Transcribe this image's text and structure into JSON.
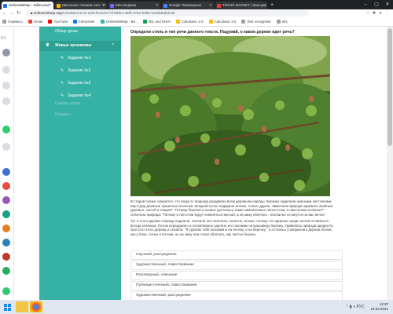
{
  "browser": {
    "tabs": [
      {
        "label": "OnlineMektep - BilimLand",
        "active": true,
        "color": "#1a73e8"
      },
      {
        "label": "Школьные Знания.com - Р",
        "active": false,
        "color": "#f4b400"
      },
      {
        "label": "Мессенджер",
        "active": false,
        "color": "#7b61ff"
      },
      {
        "label": "Google Переводчик",
        "active": false,
        "color": "#4285f4"
      },
      {
        "label": "ТЕХНО МАРКЕТ | Кальцио",
        "active": false,
        "color": "#e53935"
      }
    ],
    "new_tab": "+",
    "url_host": "onlinemektep.org",
    "url_path": "/schedule/15.03.2021/lesson/71f75bb2-48fd-4764-bdbb-5cb9b8abdc4b",
    "bookmarks": [
      {
        "label": "Сервисы",
        "color": "#9aa0a6"
      },
      {
        "label": "Gmail",
        "color": "#ea4335"
      },
      {
        "label": "YouTube",
        "color": "#ff0000"
      },
      {
        "label": "Interpreter",
        "color": "#1a73e8"
      },
      {
        "label": "OnlineMektep - Bil...",
        "color": "#35b2a5"
      },
      {
        "label": "BIL and NISH",
        "color": "#0f9d58"
      },
      {
        "label": "Calculator 2.0",
        "color": "#fbbc04"
      },
      {
        "label": "Calculator 3.0",
        "color": "#fbbc04"
      },
      {
        "label": "Text recogniser",
        "color": "#9aa0a6"
      },
      {
        "label": "el/s",
        "color": "#9aa0a6"
      }
    ]
  },
  "sidebar": {
    "top_item": "Обзор урока",
    "section": "Живые организмы",
    "tasks": [
      "Задание №1",
      "Задание №2",
      "Задание №3",
      "Задание №4"
    ],
    "faded_items": [
      "Оценка урока",
      "Ресурсы"
    ]
  },
  "lesson": {
    "question": "Определи стиль и тип речи данного текста. Подумай, о каком дереве идет речь?",
    "paragraph1": "В старой сказке говорится, что когда-то природа раздавала всем деревьям наряды. Березку наделила нежными листочками, иву в дар длинные пушистые иголочки. Мощной сосне подарила иголки, только другие. Заметила природа наряжать хвойные деревья, они ей и говорят: \"Почему березке и осинке достались такие симпатичные лепесточки, а нам иголки-колючки?\" Ответила природа: \"Почему и листочки будут появляться весной, а на зиму облетать - иголки же останутся на вас вечно\".",
    "paragraph2": "Тут и этого дерева очередь подошла. Сначала оно захотело, конечно, иголки, потому что здорово среди снегов оставаться всегда зелёным. Потом передумало и потребовало сделать его похожим на красавицу березку. Удивилась природа щедрости простого этого дерева и сказала: \"Я сделаю тебя похожим и на ёлочку, и на березку\", и осталась у капризного дерева иголки, как у ёлки, сосны и ёлочки, но на зиму они стали облетать, как листья березы.",
    "options": [
      "Научный, рассуждение",
      "Художественный, повествование",
      "Разговорный, описание",
      "Публицистический, повествование",
      "Художественный, рассуждение"
    ]
  },
  "taskbar": {
    "time": "12:37",
    "date": "15.03.2021",
    "lang": "РУС"
  }
}
